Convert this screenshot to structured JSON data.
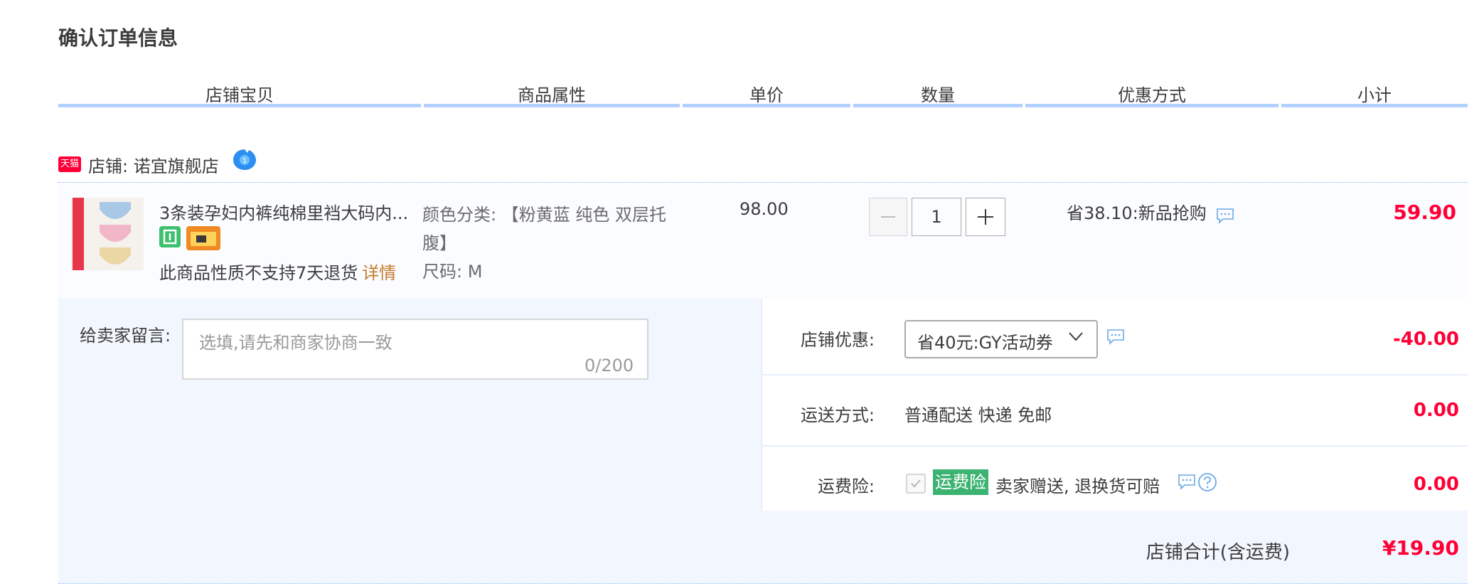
{
  "page_title": "确认订单信息",
  "columns": [
    "店铺宝贝",
    "商品属性",
    "单价",
    "数量",
    "优惠方式",
    "小计"
  ],
  "shop": {
    "badge": "天猫",
    "name": "店铺: 诺宜旗舰店"
  },
  "item": {
    "title": "3条装孕妇内裤纯棉里裆大码内...",
    "no_return_text": "此商品性质不支持7天退货",
    "detail_link": "详情",
    "attr_color": "颜色分类: 【粉黄蓝 纯色 双层托腹】",
    "attr_size": "尺码: M",
    "unit_price": "98.00",
    "quantity": "1",
    "promo": "省38.10:新品抢购",
    "subtotal": "59.90"
  },
  "message": {
    "label": "给卖家留言:",
    "placeholder": "选填,请先和商家协商一致",
    "counter": "0/200"
  },
  "shop_discount": {
    "label": "店铺优惠:",
    "selected": "省40元:GY活动券",
    "amount": "-40.00"
  },
  "delivery": {
    "label": "运送方式:",
    "value": "普通配送 快递 免邮",
    "amount": "0.00"
  },
  "insurance": {
    "label": "运费险:",
    "tag": "运费险",
    "desc": "卖家赠送, 退换货可赔",
    "amount": "0.00"
  },
  "total": {
    "label": "店铺合计(含运费)",
    "amount": "¥19.90"
  },
  "colors": {
    "accent_red": "#ff0036",
    "header_bar": "#b2d1ff",
    "panel_bg": "#f2f7ff"
  }
}
